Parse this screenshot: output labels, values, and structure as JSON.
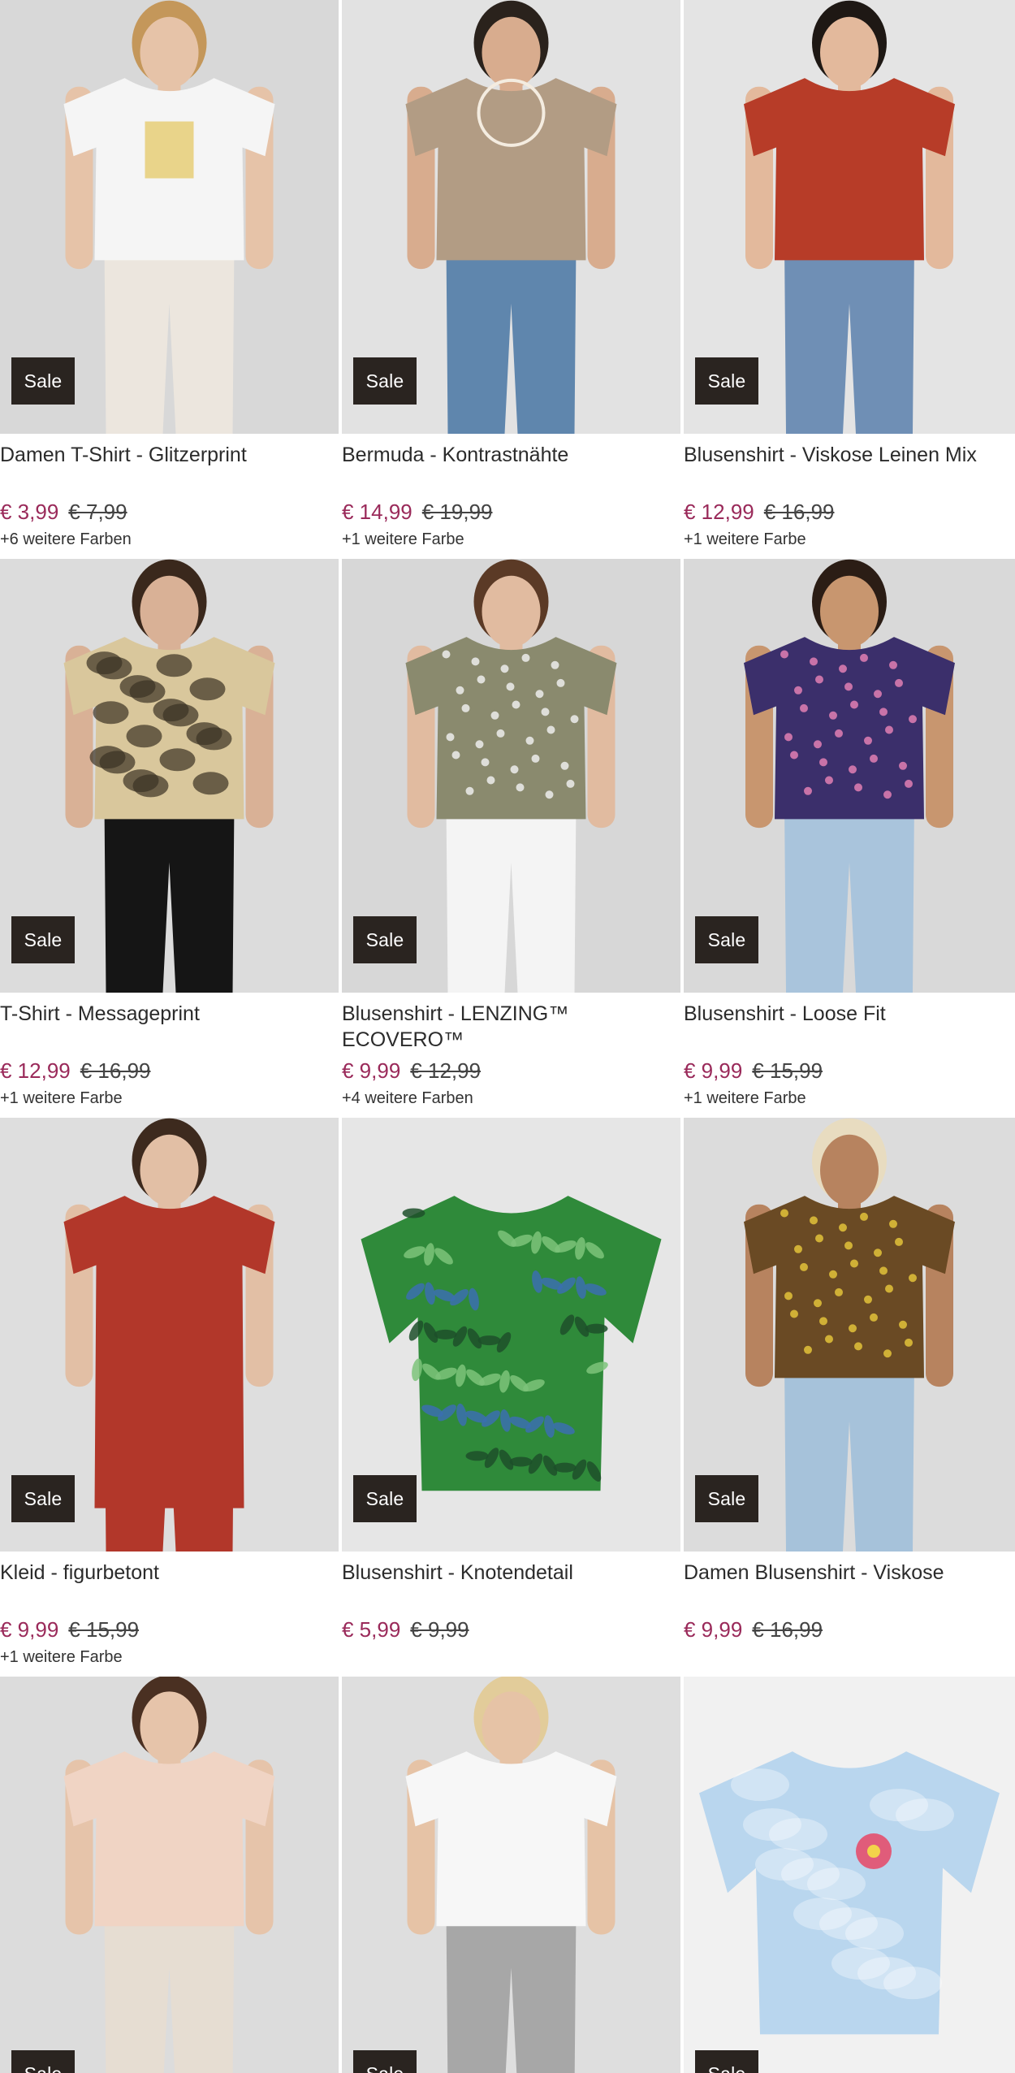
{
  "products": [
    {
      "title": "Damen T-Shirt - Glitzerprint",
      "badge": "Sale",
      "price": "€ 3,99",
      "old_price": "€ 7,99",
      "more_colors": "+6 weitere Farben",
      "bg": "#d8d8d8",
      "garment": "#f5f5f5",
      "bottom": "#ece6de",
      "skin": "#e6c3a8",
      "hair": "#c4975a"
    },
    {
      "title": "Bermuda - Kontrastnähte",
      "badge": "Sale",
      "price": "€ 14,99",
      "old_price": "€ 19,99",
      "more_colors": "+1 weitere Farbe",
      "bg": "#e2e2e2",
      "garment": "#b29c84",
      "bottom": "#5f86ad",
      "skin": "#d8ac8e",
      "hair": "#2a221c"
    },
    {
      "title": "Blusenshirt - Viskose Leinen Mix",
      "badge": "Sale",
      "price": "€ 12,99",
      "old_price": "€ 16,99",
      "more_colors": "+1 weitere Farbe",
      "bg": "#e4e4e4",
      "garment": "#b73c28",
      "bottom": "#6f8fb5",
      "skin": "#e3b99c",
      "hair": "#1e1814"
    },
    {
      "title": "T-Shirt - Messageprint",
      "badge": "Sale",
      "price": "€ 12,99",
      "old_price": "€ 16,99",
      "more_colors": "+1 weitere Farbe",
      "bg": "#dcdcdc",
      "garment": "#d9c79c",
      "bottom": "#151515",
      "skin": "#d9b196",
      "hair": "#3a281c"
    },
    {
      "title": "Blusenshirt - LENZING™ ECOVERO™",
      "badge": "Sale",
      "price": "€ 9,99",
      "old_price": "€ 12,99",
      "more_colors": "+4 weitere Farben",
      "bg": "#d7d7d7",
      "garment": "#8a8a6e",
      "bottom": "#f4f4f4",
      "skin": "#e1bba0",
      "hair": "#5b3a26"
    },
    {
      "title": "Blusenshirt - Loose Fit",
      "badge": "Sale",
      "price": "€ 9,99",
      "old_price": "€ 15,99",
      "more_colors": "+1 weitere Farbe",
      "bg": "#d9d9d9",
      "garment": "#3b2f6b",
      "bottom": "#a9c4dc",
      "skin": "#c8966f",
      "hair": "#2b1d15"
    },
    {
      "title": "Kleid - figurbetont",
      "badge": "Sale",
      "price": "€ 9,99",
      "old_price": "€ 15,99",
      "more_colors": "+1 weitere Farbe",
      "bg": "#dedede",
      "garment": "#b2372a",
      "bottom": "#b2372a",
      "skin": "#e2bfa5",
      "hair": "#3d2a1e"
    },
    {
      "title": "Blusenshirt - Knotendetail",
      "badge": "Sale",
      "price": "€ 5,99",
      "old_price": "€ 9,99",
      "more_colors": "",
      "bg": "#e6e6e6",
      "garment": "#2f8a3a",
      "bottom": "#e6e6e6",
      "skin": "#e6e6e6",
      "hair": "#e6e6e6"
    },
    {
      "title": "Damen Blusenshirt - Viskose",
      "badge": "Sale",
      "price": "€ 9,99",
      "old_price": "€ 16,99",
      "more_colors": "",
      "bg": "#dcdcdc",
      "garment": "#6a4a24",
      "bottom": "#a6c2da",
      "skin": "#b7835f",
      "hair": "#e8dcc0"
    },
    {
      "title": "",
      "badge": "Sale",
      "price": "",
      "old_price": "",
      "more_colors": "",
      "bg": "#dcdcdc",
      "garment": "#f0d4c4",
      "bottom": "#e6ddd2",
      "skin": "#e6c4aa",
      "hair": "#4a3022"
    },
    {
      "title": "",
      "badge": "Sale",
      "price": "",
      "old_price": "",
      "more_colors": "",
      "bg": "#dedede",
      "garment": "#f7f7f7",
      "bottom": "#a7a7a7",
      "skin": "#e6c3a6",
      "hair": "#e2cc9a"
    },
    {
      "title": "",
      "badge": "Sale",
      "price": "",
      "old_price": "",
      "more_colors": "",
      "bg": "#f1f1f1",
      "garment": "#b9d6ee",
      "bottom": "#f1f1f1",
      "skin": "#f1f1f1",
      "hair": "#f1f1f1"
    }
  ]
}
